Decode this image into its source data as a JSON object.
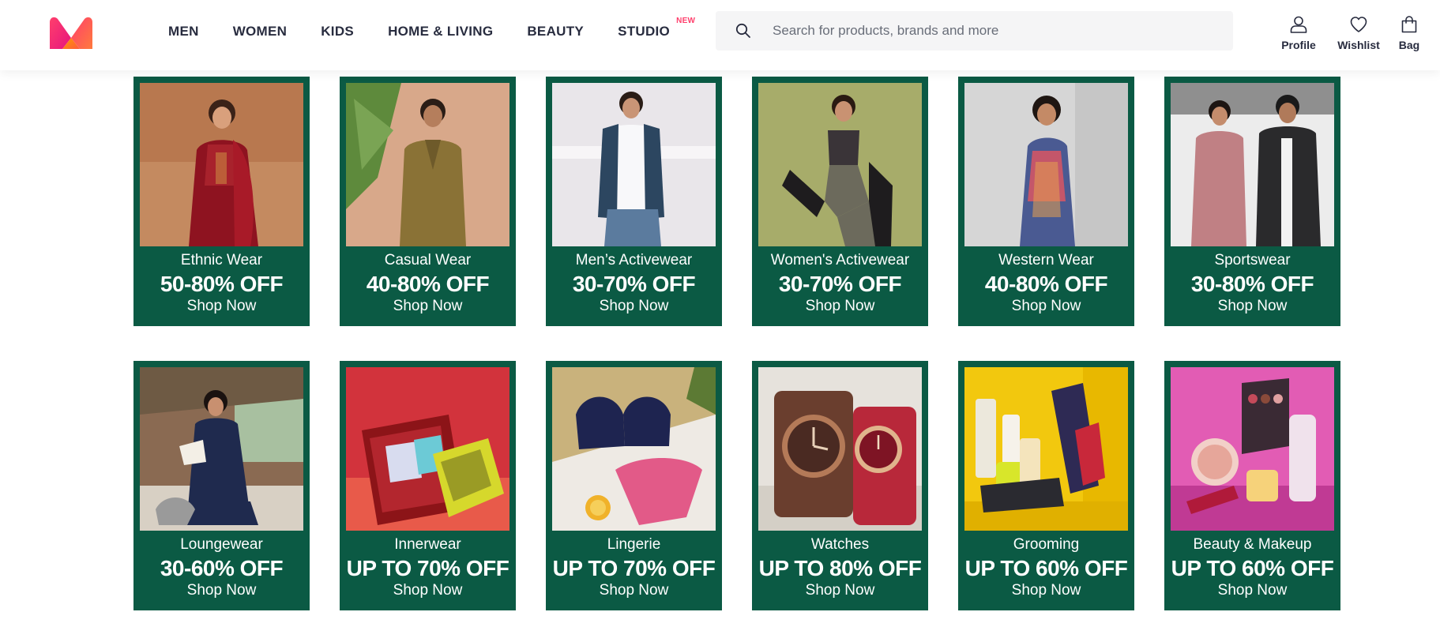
{
  "header": {
    "logo": {
      "icon": "myntra-logo-icon",
      "colors": [
        "#ff3f6c",
        "#ff8a00",
        "#e6157e"
      ]
    },
    "nav": [
      {
        "label": "MEN"
      },
      {
        "label": "WOMEN"
      },
      {
        "label": "KIDS"
      },
      {
        "label": "HOME & LIVING"
      },
      {
        "label": "BEAUTY"
      },
      {
        "label": "STUDIO",
        "badge": "NEW"
      }
    ],
    "search": {
      "placeholder": "Search for products, brands and more",
      "value": ""
    },
    "actions": [
      {
        "label": "Profile",
        "icon": "user-icon"
      },
      {
        "label": "Wishlist",
        "icon": "heart-icon"
      },
      {
        "label": "Bag",
        "icon": "shopping-bag-icon"
      }
    ]
  },
  "theme": {
    "card_bg": "#0b5a44",
    "brand_pink": "#ff3f6c",
    "text_dark": "#282c3f"
  },
  "cards": [
    {
      "category": "Ethnic Wear",
      "discount": "50-80% OFF",
      "cta": "Shop Now"
    },
    {
      "category": "Casual Wear",
      "discount": "40-80% OFF",
      "cta": "Shop Now"
    },
    {
      "category": "Men’s Activewear",
      "discount": "30-70% OFF",
      "cta": "Shop Now"
    },
    {
      "category": "Women's Activewear",
      "discount": "30-70% OFF",
      "cta": "Shop Now"
    },
    {
      "category": "Western Wear",
      "discount": "40-80% OFF",
      "cta": "Shop Now"
    },
    {
      "category": "Sportswear",
      "discount": "30-80% OFF",
      "cta": "Shop Now"
    },
    {
      "category": "Loungewear",
      "discount": "30-60% OFF",
      "cta": "Shop Now"
    },
    {
      "category": "Innerwear",
      "discount": "UP TO 70% OFF",
      "cta": "Shop Now"
    },
    {
      "category": "Lingerie",
      "discount": "UP TO 70% OFF",
      "cta": "Shop Now"
    },
    {
      "category": "Watches",
      "discount": "UP TO 80% OFF",
      "cta": "Shop Now"
    },
    {
      "category": "Grooming",
      "discount": "UP TO 60% OFF",
      "cta": "Shop Now"
    },
    {
      "category": "Beauty & Makeup",
      "discount": "UP TO 60% OFF",
      "cta": "Shop Now"
    }
  ]
}
